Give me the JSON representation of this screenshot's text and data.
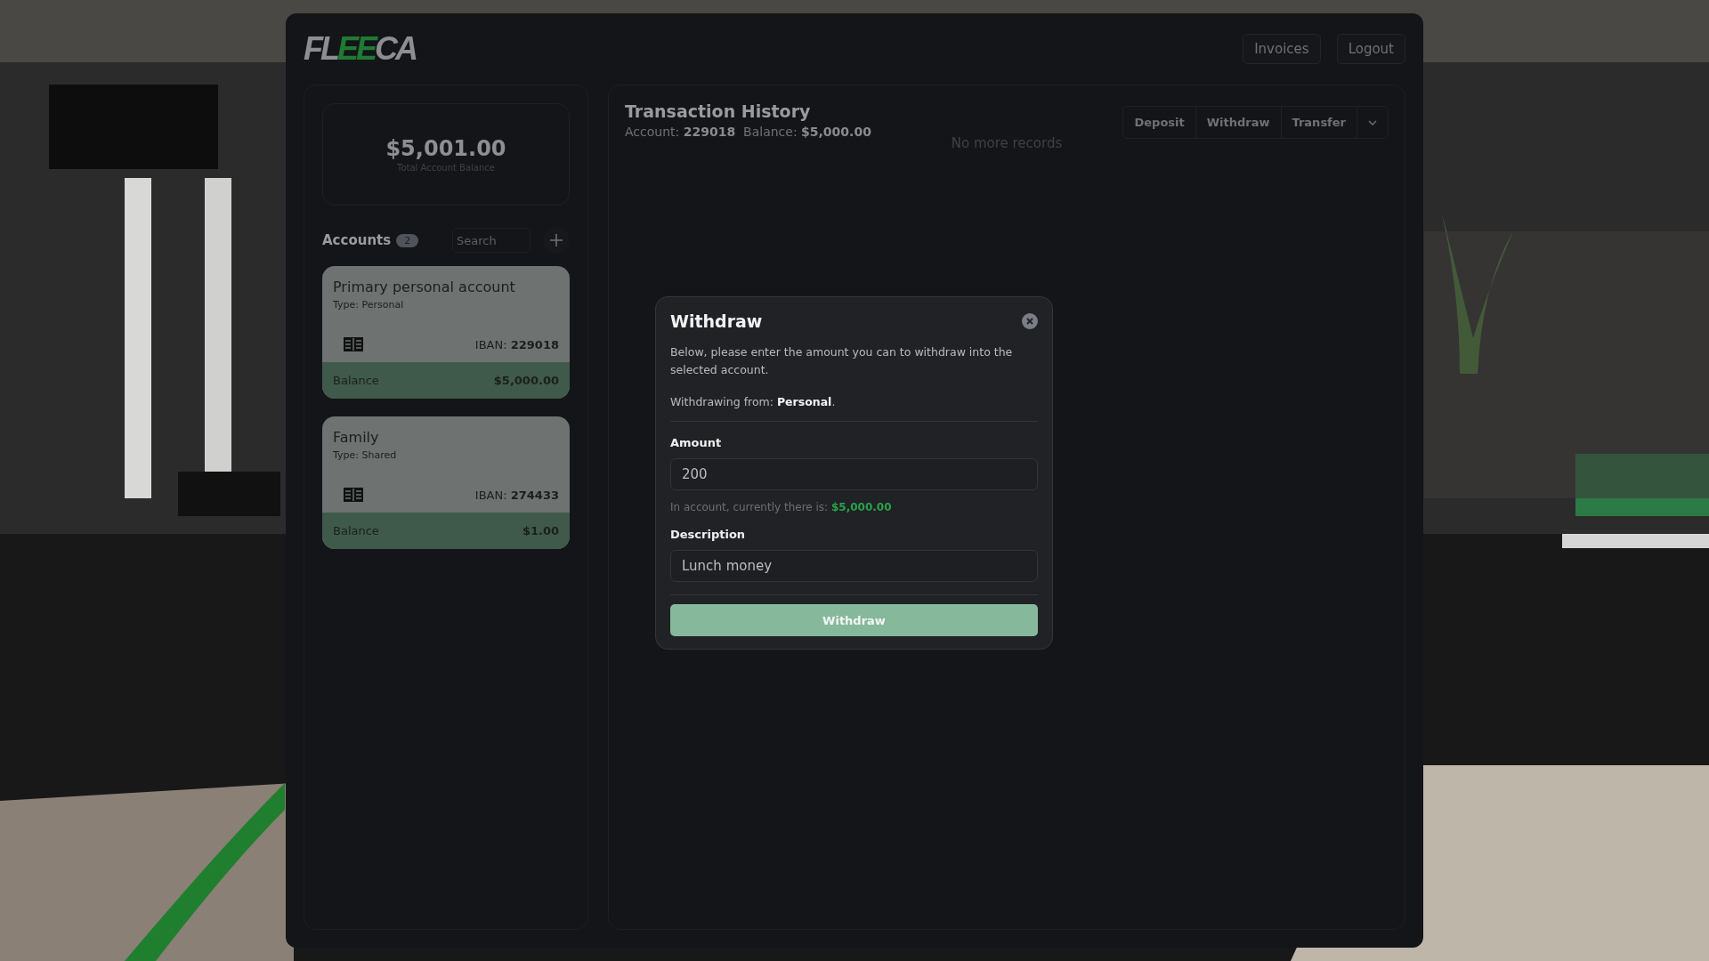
{
  "header": {
    "logo": [
      {
        "text": "FL",
        "accent": false
      },
      {
        "text": "EE",
        "accent": true
      },
      {
        "text": "CA",
        "accent": false
      }
    ],
    "buttons": [
      "Invoices",
      "Logout"
    ]
  },
  "summary": {
    "total": "$5,001.00",
    "caption": "Total Account Balance"
  },
  "accounts": {
    "title": "Accounts",
    "count": "2",
    "search": {
      "placeholder": "Search"
    },
    "items": [
      {
        "name": "Primary personal account",
        "type": "Type: Personal",
        "iban_label": "IBAN:",
        "iban": "229018",
        "balance_label": "Balance",
        "balance": "$5,000.00"
      },
      {
        "name": "Family",
        "type": "Type: Shared",
        "iban_label": "IBAN:",
        "iban": "274433",
        "balance_label": "Balance",
        "balance": "$1.00"
      }
    ]
  },
  "history": {
    "title": "Transaction History",
    "subtitle": "Account: **229018**  Balance: **$5,000.00**",
    "actions": [
      "Deposit",
      "Withdraw",
      "Transfer"
    ],
    "empty": "No more records"
  },
  "modal": {
    "title": "Withdraw",
    "text": "Below, please enter the amount you can to withdraw into the selected account.",
    "source": "Withdrawing from: **Personal**.",
    "fields": [
      {
        "label": "Amount",
        "value": "200"
      },
      {
        "label": "Description",
        "value": "Lunch money"
      }
    ],
    "hint": "In account, currently there is:",
    "hint_amount": "$5,000.00",
    "submit": "Withdraw"
  }
}
